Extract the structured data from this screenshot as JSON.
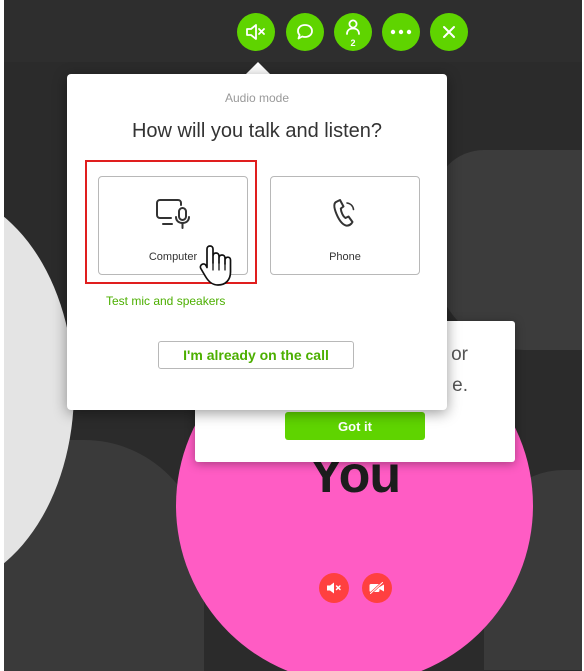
{
  "toolbar": {
    "buttons": [
      {
        "name": "mute-audio-button",
        "icon": "speaker-muted-icon"
      },
      {
        "name": "chat-button",
        "icon": "chat-bubble-icon"
      },
      {
        "name": "participants-button",
        "icon": "person-icon",
        "badge": "2"
      },
      {
        "name": "more-options-button",
        "icon": "ellipsis-icon"
      },
      {
        "name": "leave-button",
        "icon": "close-icon"
      }
    ],
    "accent_color": "#5fd400"
  },
  "dialog": {
    "subtitle": "Audio mode",
    "title": "How will you talk and listen?",
    "options": [
      {
        "label": "Computer",
        "icon": "computer-mic-icon"
      },
      {
        "label": "Phone",
        "icon": "phone-icon"
      }
    ],
    "test_link": "Test mic and speakers",
    "already_button": "I'm already on the call"
  },
  "tooltip": {
    "line1_partial": "or",
    "line2_partial": "e.",
    "button": "Got it"
  },
  "self_view": {
    "label": "You",
    "color": "#ff5cc4",
    "controls": [
      {
        "name": "self-mute-button",
        "icon": "speaker-muted-icon"
      },
      {
        "name": "self-video-off-button",
        "icon": "video-off-icon"
      }
    ]
  }
}
